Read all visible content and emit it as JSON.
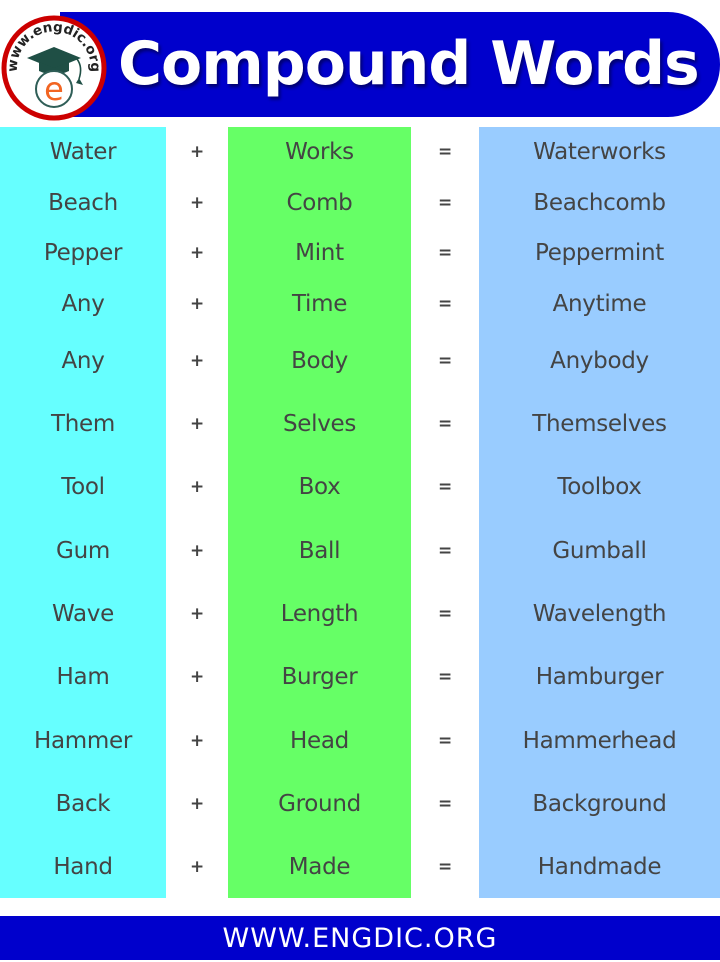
{
  "header": {
    "title": "Compound Words",
    "logo_text": "www.engdic.org",
    "logo_letter": "e",
    "banner_color": "#0000CC"
  },
  "colors": {
    "first_column": "#66FFFF",
    "second_column": "#66FF66",
    "result_column": "#99CCFF",
    "text": "#444444",
    "logo_ring": "#CC0000",
    "logo_letter": "#F26522"
  },
  "operators": {
    "plus": "+",
    "equals": "="
  },
  "rows": [
    {
      "first": "Water",
      "second": "Works",
      "result": "Waterworks"
    },
    {
      "first": "Beach",
      "second": "Comb",
      "result": "Beachcomb"
    },
    {
      "first": "Pepper",
      "second": "Mint",
      "result": "Peppermint"
    },
    {
      "first": "Any",
      "second": "Time",
      "result": "Anytime"
    },
    {
      "first": "Any",
      "second": "Body",
      "result": "Anybody"
    },
    {
      "first": "Them",
      "second": "Selves",
      "result": "Themselves"
    },
    {
      "first": "Tool",
      "second": "Box",
      "result": "Toolbox"
    },
    {
      "first": "Gum",
      "second": "Ball",
      "result": "Gumball"
    },
    {
      "first": "Wave",
      "second": "Length",
      "result": "Wavelength"
    },
    {
      "first": "Ham",
      "second": "Burger",
      "result": "Hamburger"
    },
    {
      "first": "Hammer",
      "second": "Head",
      "result": "Hammerhead"
    },
    {
      "first": "Back",
      "second": "Ground",
      "result": "Background"
    },
    {
      "first": "Hand",
      "second": "Made",
      "result": "Handmade"
    }
  ],
  "footer": {
    "text": "WWW.ENGDIC.ORG"
  }
}
